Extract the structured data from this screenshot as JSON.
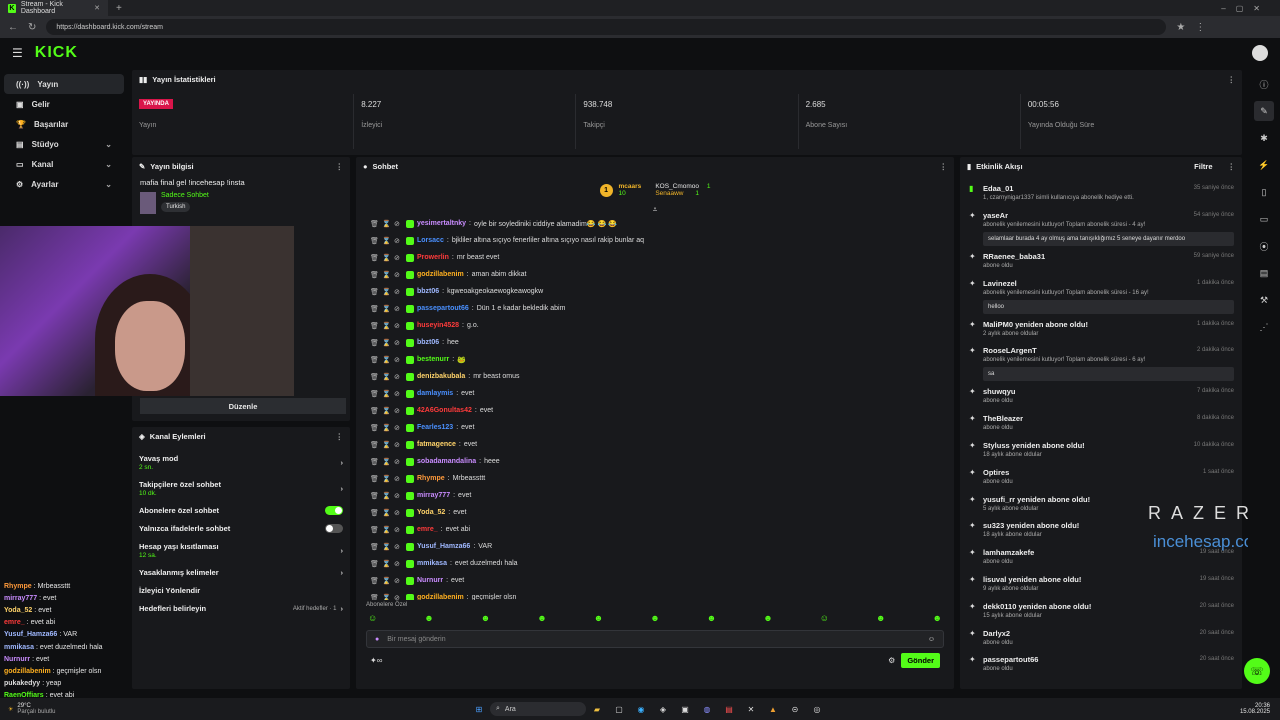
{
  "browser": {
    "tab_title": "Stream - Kick Dashboard",
    "url": "https://dashboard.kick.com/stream"
  },
  "brand": {
    "logo": "KICK",
    "accent": "#53fc18"
  },
  "sidebar": {
    "items": [
      {
        "label": "Yayın",
        "icon": "broadcast-icon",
        "active": true
      },
      {
        "label": "Gelir",
        "icon": "wallet-icon"
      },
      {
        "label": "Başarılar",
        "icon": "trophy-icon"
      },
      {
        "label": "Stüdyo",
        "icon": "studio-icon",
        "chevron": true
      },
      {
        "label": "Kanal",
        "icon": "channel-icon",
        "chevron": true
      },
      {
        "label": "Ayarlar",
        "icon": "gear-icon",
        "chevron": true
      }
    ]
  },
  "stats": {
    "title": "Yayın İstatistikleri",
    "items": [
      {
        "value": "YAYINDA",
        "label": "Yayın",
        "badge": true
      },
      {
        "value": "8.227",
        "label": "İzleyici"
      },
      {
        "value": "938.748",
        "label": "Takipçi"
      },
      {
        "value": "2.685",
        "label": "Abone Sayısı"
      },
      {
        "value": "00:05:56",
        "label": "Yayında Olduğu Süre"
      }
    ]
  },
  "stream_info": {
    "title": "Yayın bilgisi",
    "stream_title": "mafia final gel !incehesap !insta",
    "category": "Sadece Sohbet",
    "tag": "Turkish",
    "edit_label": "Düzenle"
  },
  "channel_actions": {
    "title": "Kanal Eylemleri",
    "rows": [
      {
        "label": "Yavaş mod",
        "sub": "2 sn.",
        "type": "chevron"
      },
      {
        "label": "Takipçilere özel sohbet",
        "sub": "10 dk.",
        "type": "chevron"
      },
      {
        "label": "Abonelere özel sohbet",
        "type": "toggle-on"
      },
      {
        "label": "Yalnızca ifadelerle sohbet",
        "type": "toggle-off"
      },
      {
        "label": "Hesap yaşı kısıtlaması",
        "sub": "12 sa.",
        "type": "chevron"
      },
      {
        "label": "Yasaklanmış kelimeler",
        "type": "chevron"
      },
      {
        "label": "İzleyici Yönlendir",
        "type": "none"
      },
      {
        "label": "Hedefleri belirleyin",
        "type": "goal",
        "extra": "Aktif hedefler · 1"
      }
    ]
  },
  "chat": {
    "title": "Sohbet",
    "top_gifters": [
      {
        "name": "mcaars",
        "count": "10"
      },
      {
        "name": "KOS_Cmomoo",
        "count": "1"
      },
      {
        "name": "Senaaww",
        "count": "1"
      }
    ],
    "messages": [
      {
        "user": "yesimertaltnky",
        "color": "#c98cff",
        "text": "oyle bir soylediniki ciddiye alamadim😂 😂 😂"
      },
      {
        "user": "Lorsacc",
        "color": "#4a90ff",
        "text": "bjkliler altına sıçıyo fenerliler altına sıçıyo nasıl rakip bunlar aq"
      },
      {
        "user": "Prowerlin",
        "color": "#ff3b3b",
        "text": "mr beast evet"
      },
      {
        "user": "godzillabenim",
        "color": "#ffb020",
        "text": "aman abim dikkat"
      },
      {
        "user": "bbzt06",
        "color": "#9fb8ff",
        "text": "kgweoakgeokaewogkeawogkw"
      },
      {
        "user": "passepartout66",
        "color": "#4a90ff",
        "text": "Dün 1 e kadar bekledik abim"
      },
      {
        "user": "huseyin4528",
        "color": "#ff3b3b",
        "text": "g.o."
      },
      {
        "user": "bbzt06",
        "color": "#9fb8ff",
        "text": "hee"
      },
      {
        "user": "bestenurr",
        "color": "#53fc18",
        "text": "🐸"
      },
      {
        "user": "denizbakubala",
        "color": "#ffd36a",
        "text": "mr beast omus"
      },
      {
        "user": "damlaymis",
        "color": "#4a90ff",
        "text": "evet"
      },
      {
        "user": "42A6Gonultas42",
        "color": "#ff3b3b",
        "text": "evet"
      },
      {
        "user": "Fearles123",
        "color": "#4a90ff",
        "text": "evet"
      },
      {
        "user": "fatmagence",
        "color": "#ffd36a",
        "text": "evet"
      },
      {
        "user": "sobadamandalina",
        "color": "#c98cff",
        "text": "heee"
      },
      {
        "user": "Rhympe",
        "color": "#ff9a3b",
        "text": "Mrbeassttt"
      },
      {
        "user": "mirray777",
        "color": "#c98cff",
        "text": "evet"
      },
      {
        "user": "Yoda_52",
        "color": "#ffd36a",
        "text": "evet"
      },
      {
        "user": "emre_",
        "color": "#ff3b3b",
        "text": "evet abi"
      },
      {
        "user": "Yusuf_Hamza66",
        "color": "#9fb8ff",
        "text": "VAR"
      },
      {
        "user": "mmikasa",
        "color": "#9fb8ff",
        "text": "evet duzelmedı hala"
      },
      {
        "user": "Nurnurr",
        "color": "#c98cff",
        "text": "evet"
      },
      {
        "user": "godzillabenim",
        "color": "#ffb020",
        "text": "geçmişler olsn"
      }
    ],
    "sub_only_label": "Abonelere Özel",
    "input_placeholder": "Bir mesaj gönderin",
    "send_label": "Gönder"
  },
  "events": {
    "title": "Etkinlik Akışı",
    "filter_label": "Filtre",
    "items": [
      {
        "name": "Edaa_01",
        "desc": "1, czarnynigar1337 isimli kullanıcıya abonelik hediye etti.",
        "time": "35 saniye önce",
        "icon": "gift-icon"
      },
      {
        "name": "yaseAr",
        "desc": "abonelik yenilemesini kutluyor! Toplam abonelik süresi - 4 ay!",
        "time": "54 saniye önce",
        "icon": "star-icon",
        "msg": "selamlaar burada 4 ay olmuş ama tanışıklığımız 5 seneye dayanır merdoo"
      },
      {
        "name": "RRaenee_baba31",
        "desc": "abone oldu",
        "time": "59 saniye önce",
        "icon": "star-icon"
      },
      {
        "name": "Lavinezel",
        "desc": "abonelik yenilemesini kutluyor! Toplam abonelik süresi - 16 ay!",
        "time": "1 dakika önce",
        "icon": "star-icon",
        "msg": "helloo"
      },
      {
        "name": "MaliPM0 yeniden abone oldu!",
        "desc": "2 aylık abone oldular",
        "time": "1 dakika önce",
        "icon": "star-icon"
      },
      {
        "name": "RooseLArgenT",
        "desc": "abonelik yenilemesini kutluyor! Toplam abonelik süresi - 6 ay!",
        "time": "2 dakika önce",
        "icon": "star-icon",
        "msg": "sa"
      },
      {
        "name": "shuwqyu",
        "desc": "abone oldu",
        "time": "7 dakika önce",
        "icon": "star-icon"
      },
      {
        "name": "TheBleazer",
        "desc": "abone oldu",
        "time": "8 dakika önce",
        "icon": "star-icon"
      },
      {
        "name": "Styluss yeniden abone oldu!",
        "desc": "18 aylık abone oldular",
        "time": "10 dakika önce",
        "icon": "star-icon"
      },
      {
        "name": "Optires",
        "desc": "abone oldu",
        "time": "1 saat önce",
        "icon": "star-icon"
      },
      {
        "name": "yusufi_rr yeniden abone oldu!",
        "desc": "5 aylık abone oldular",
        "time": "",
        "icon": "star-icon"
      },
      {
        "name": "su323 yeniden abone oldu!",
        "desc": "18 aylık abone oldular",
        "time": "",
        "icon": "star-icon"
      },
      {
        "name": "lamhamzakefe",
        "desc": "abone oldu",
        "time": "19 saat önce",
        "icon": "star-icon"
      },
      {
        "name": "lisuval yeniden abone oldu!",
        "desc": "9 aylık abone oldular",
        "time": "19 saat önce",
        "icon": "star-icon"
      },
      {
        "name": "dekk0110 yeniden abone oldu!",
        "desc": "15 aylık abone oldular",
        "time": "20 saat önce",
        "icon": "star-icon"
      },
      {
        "name": "Darlyx2",
        "desc": "abone oldu",
        "time": "20 saat önce",
        "icon": "star-icon"
      },
      {
        "name": "passepartout66",
        "desc": "abone oldu",
        "time": "20 saat önce",
        "icon": "star-icon"
      }
    ]
  },
  "watermark": {
    "razer": "RAZER",
    "brand": "incehesap.com"
  },
  "overlay_chat": [
    {
      "user": "Rhympe",
      "text": "Mrbeassttt",
      "color": "#ff9a3b"
    },
    {
      "user": "mirray777",
      "text": "evet",
      "color": "#c98cff"
    },
    {
      "user": "Yoda_52",
      "text": "evet",
      "color": "#ffd36a"
    },
    {
      "user": "emre_",
      "text": "evet abi",
      "color": "#ff3b3b"
    },
    {
      "user": "Yusuf_Hamza66",
      "text": "VAR",
      "color": "#9fb8ff"
    },
    {
      "user": "mmikasa",
      "text": "evet duzelmedı hala",
      "color": "#9fb8ff"
    },
    {
      "user": "Nurnurr",
      "text": "evet",
      "color": "#c98cff"
    },
    {
      "user": "godzillabenim",
      "text": "geçmişler olsn",
      "color": "#ffb020"
    },
    {
      "user": "pukakedyy",
      "text": "yeap",
      "color": "#ddd"
    },
    {
      "user": "RaenOffiars",
      "text": "evet abi",
      "color": "#53fc18"
    }
  ],
  "taskbar": {
    "weather_temp": "29°C",
    "weather_desc": "Parçalı bulutlu",
    "search": "Ara",
    "time": "20:36",
    "date": "15.08.2025"
  }
}
